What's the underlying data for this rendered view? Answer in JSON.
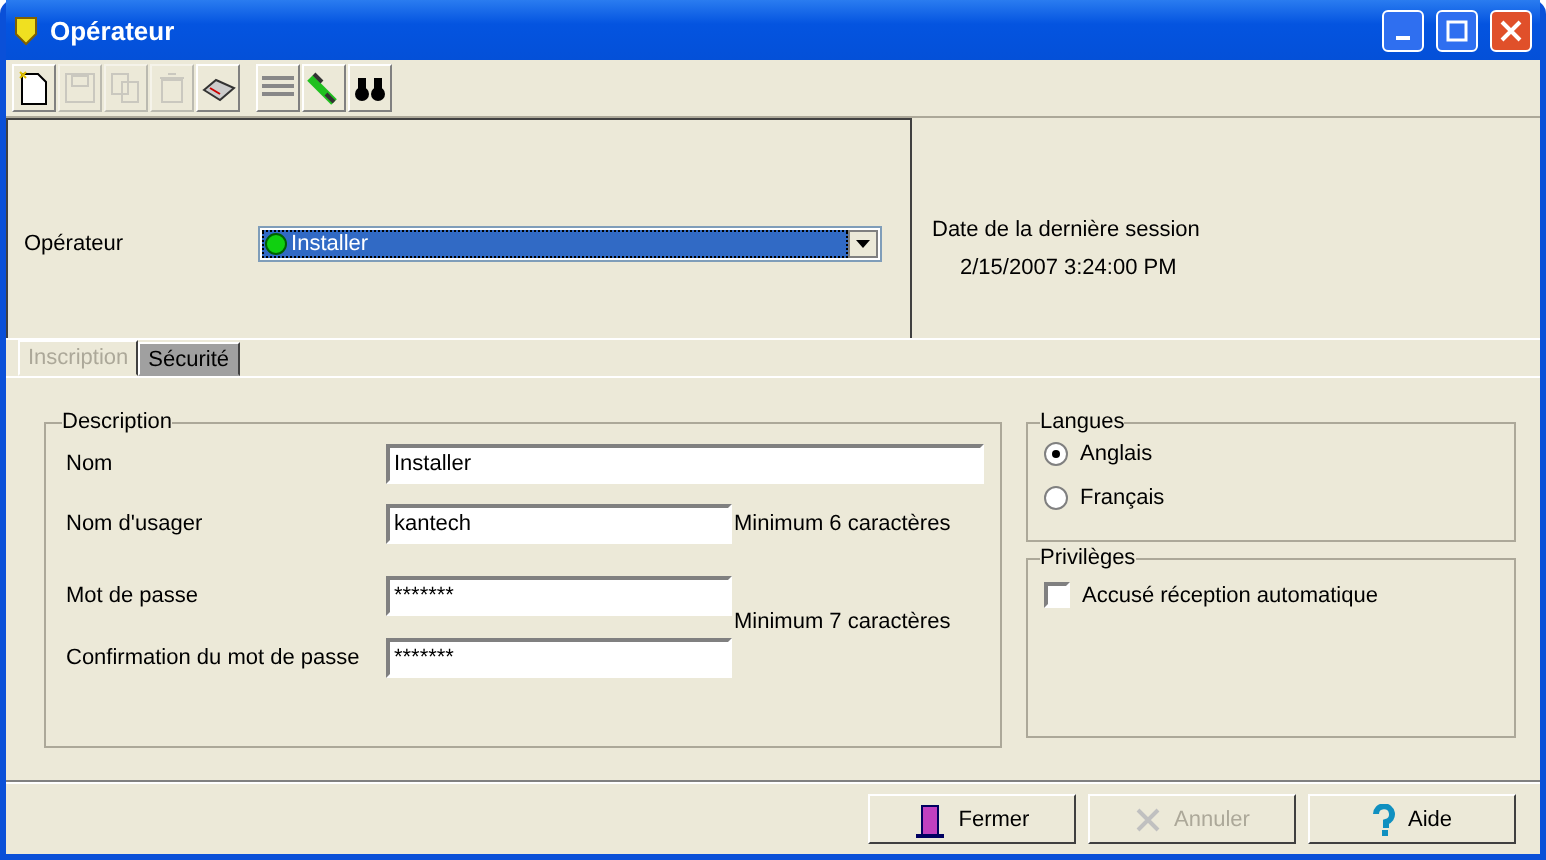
{
  "window": {
    "title": "Opérateur"
  },
  "toolbar": [
    {
      "kind": "new",
      "disabled": false
    },
    {
      "kind": "save",
      "disabled": true
    },
    {
      "kind": "copy",
      "disabled": true
    },
    {
      "kind": "delete",
      "disabled": true
    },
    {
      "kind": "print",
      "disabled": false
    },
    {
      "kind": "list",
      "disabled": false
    },
    {
      "kind": "link",
      "disabled": false
    },
    {
      "kind": "find",
      "disabled": false
    }
  ],
  "operator": {
    "label": "Opérateur",
    "value": "Installer"
  },
  "last_session": {
    "label": "Date de la dernière session",
    "value": "2/15/2007 3:24:00 PM"
  },
  "tabs": [
    {
      "label": "Inscription",
      "selected": true
    },
    {
      "label": "Sécurité",
      "selected": false
    }
  ],
  "description": {
    "title": "Description",
    "fields": [
      {
        "label": "Nom",
        "value": "Installer",
        "wide": true
      },
      {
        "label": "Nom d'usager",
        "value": "kantech",
        "hint": "Minimum 6 caractères"
      },
      {
        "label": "Mot de passe",
        "value": "*******"
      },
      {
        "label": "Confirmation du mot de passe",
        "value": "*******"
      }
    ],
    "password_hint": "Minimum 7 caractères"
  },
  "languages": {
    "title": "Langues",
    "options": [
      {
        "label": "Anglais",
        "selected": true
      },
      {
        "label": "Français",
        "selected": false
      }
    ]
  },
  "privileges": {
    "title": "Privilèges",
    "options": [
      {
        "label": "Accusé réception automatique",
        "checked": false
      }
    ]
  },
  "buttons": [
    {
      "kind": "close",
      "label": "Fermer",
      "disabled": false
    },
    {
      "kind": "cancel",
      "label": "Annuler",
      "disabled": true
    },
    {
      "kind": "help",
      "label": "Aide",
      "disabled": false
    }
  ]
}
